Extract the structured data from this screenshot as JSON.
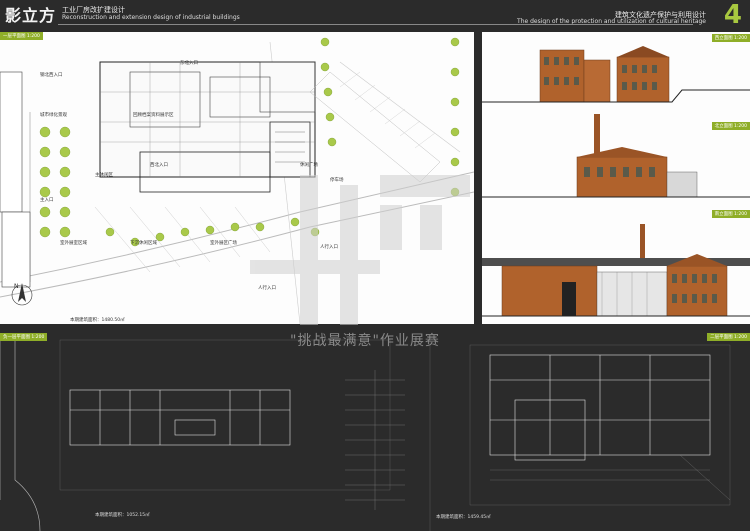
{
  "header": {
    "logo": "影立方",
    "subtitle_cn": "工业厂房改扩建设计",
    "subtitle_en": "Reconstruction and extension design of industrial buildings",
    "title_cn": "建筑文化遗产保护与利用设计",
    "title_en": "The design of the protection and utilization of cultural heritage",
    "sheet_number": "4"
  },
  "site_plan": {
    "tag": "一层平面图 1:200",
    "labels": [
      "钢北西入口",
      "城市绿化景观",
      "主入口",
      "回顾档案资料展示区",
      "东北入口",
      "室外展室区域",
      "下沉休闲区域",
      "室外展区广场",
      "休闲广场",
      "停车场",
      "人行入口",
      "人行入口",
      "西北入口",
      "主休闲区"
    ],
    "area": "本期建筑面积：1480.50㎡"
  },
  "elevations": [
    {
      "tag": "西立面图 1:200"
    },
    {
      "tag": "北立面图 1:200"
    },
    {
      "tag": "南立面图 1:200"
    }
  ],
  "lower_plans": [
    {
      "tag": "负一层平面图 1:200",
      "area": "本期建筑面积：1052.15㎡"
    },
    {
      "tag": "二层平面图 1:200",
      "area": "本期建筑面积：1459.45㎡"
    }
  ],
  "watermark": "\"挑战最满意\"作业展赛",
  "colors": {
    "accent": "#8fae28",
    "background": "#2b2b2b",
    "brick": "#b0622c"
  }
}
